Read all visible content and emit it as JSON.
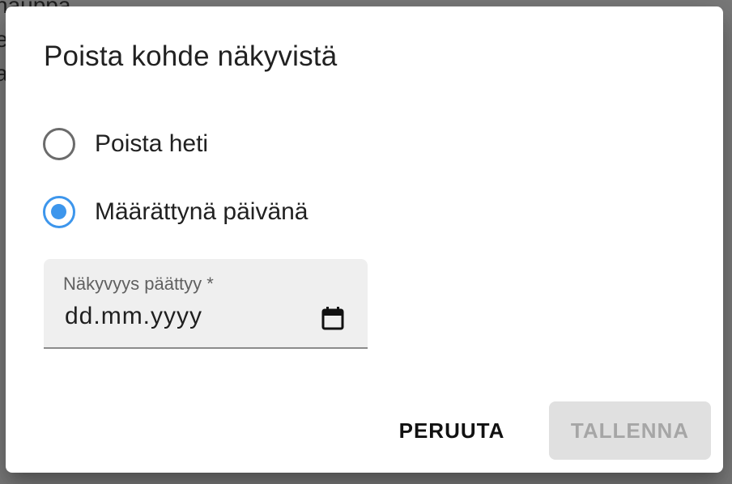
{
  "background": {
    "lines": [
      "hauppa",
      "e",
      "a"
    ]
  },
  "dialog": {
    "title": "Poista kohde näkyvistä",
    "options": [
      {
        "label": "Poista heti",
        "selected": false
      },
      {
        "label": "Määrättynä päivänä",
        "selected": true
      }
    ],
    "date_field": {
      "label": "Näkyvyys päättyy *",
      "placeholder": "dd.mm.yyyy",
      "icon": "calendar-icon"
    },
    "buttons": {
      "cancel": "PERUUTA",
      "save": "TALLENNA",
      "save_disabled": true
    }
  },
  "colors": {
    "accent": "#3d96ec",
    "backdrop": "#7a7a7a",
    "disabled_text": "#a6a6a6",
    "disabled_bg": "#e0e0e0"
  }
}
